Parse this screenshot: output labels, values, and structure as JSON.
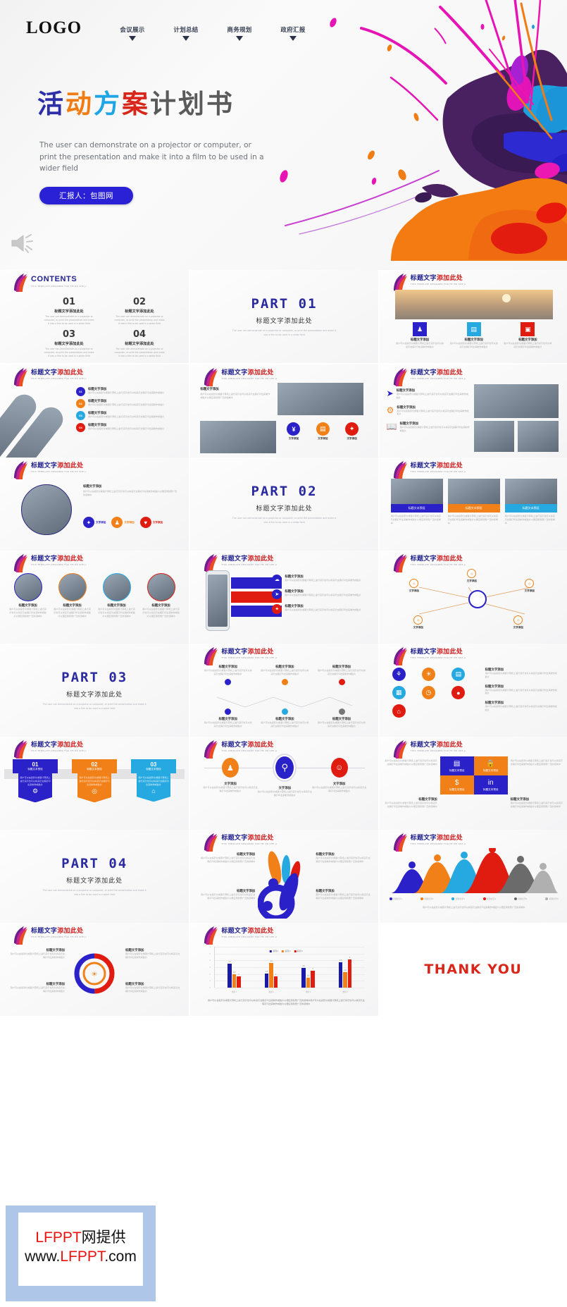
{
  "hero": {
    "logo": "LOGO",
    "nav": [
      {
        "label": "会议展示"
      },
      {
        "label": "计划总结"
      },
      {
        "label": "商务规划"
      },
      {
        "label": "政府汇报"
      }
    ],
    "title_chars": [
      "活",
      "动",
      "方",
      "案",
      "计",
      "划",
      "书"
    ],
    "subtitle": "The user can demonstrate on a projector or computer, or print the presentation and make it into a film to be used in a wider field",
    "presenter_button": "汇报人：包图网"
  },
  "slide_header": {
    "title_blue": "标题文字",
    "title_red": "添加此处",
    "subtitle_en": "THIS TEMPLATE DESIGNED FOR FEI ER SHE JI"
  },
  "contents": {
    "title": "CONTENTS",
    "subtitle_en": "THIS TEMPLATE DESIGNED FOR FEI ER SHE JI",
    "items": [
      {
        "num": "01",
        "title": "标题文字添加此处",
        "desc": "The user can demonstrate on a projector or computer, or print the presentation and make it into a film to be used in a wider field"
      },
      {
        "num": "02",
        "title": "标题文字添加此处",
        "desc": "The user can demonstrate on a projector or computer, or print the presentation and make it into a film to be used in a wider field"
      },
      {
        "num": "03",
        "title": "标题文字添加此处",
        "desc": "The user can demonstrate on a projector or computer, or print the presentation and make it into a film to be used in a wider field"
      },
      {
        "num": "04",
        "title": "标题文字添加此处",
        "desc": "The user can demonstrate on a projector or computer, or print the presentation and make it into a film to be used in a wider field"
      }
    ]
  },
  "parts": [
    {
      "big": "PART 01",
      "sub": "标题文字添加此处",
      "en": "The user can demonstrate on a projector or computer, or print the presentation and make it into a film to be used in a wider field"
    },
    {
      "big": "PART 02",
      "sub": "标题文字添加此处",
      "en": "The user can demonstrate on a projector or computer, or print the presentation and make it into a film to be used in a wider field"
    },
    {
      "big": "PART 03",
      "sub": "标题文字添加此处",
      "en": "The user can demonstrate on a projector or computer, or print the presentation and make it into a film to be used in a wider field"
    },
    {
      "big": "PART 04",
      "sub": "标题文字添加此处",
      "en": "The user can demonstrate on a projector or computer, or print the presentation and make it into a film to be used in a wider field"
    }
  ],
  "common": {
    "item_title": "标题文字添加",
    "text_add": "文字添加",
    "box_label": "标题文本预设",
    "body": "用户可以在投影仪或者计算机上进行演示也可以将演示文稿打印出来制作成胶片以便应用到更广泛的领域中",
    "body_short": "用户可以在投影仪或者计算机上进行演示也可以将演示文稿打印出来制作成胶片"
  },
  "closing": {
    "thank_you": "THANK YOU"
  },
  "chart_data": {
    "type": "bar",
    "title": "标题文字添加此处",
    "categories": [
      "类别 1",
      "类别 2",
      "类别 3",
      "类别 4"
    ],
    "series": [
      {
        "name": "系列 1",
        "color": "#1a1aa8",
        "values": [
          4.3,
          2.5,
          3.5,
          4.5
        ]
      },
      {
        "name": "系列 2",
        "color": "#f28019",
        "values": [
          2.4,
          4.4,
          1.8,
          2.8
        ]
      },
      {
        "name": "系列 3",
        "color": "#e01b10",
        "values": [
          2.0,
          2.0,
          3.0,
          5.0
        ]
      }
    ],
    "ylim": [
      0,
      6
    ],
    "yticks": [
      0,
      1,
      2,
      3,
      4,
      5,
      6
    ],
    "xlabel": "",
    "ylabel": "",
    "grid": true,
    "legend_position": "top-center",
    "note": "用户可以在投影仪或者计算机上进行演示也可以将演示文稿打印出来制作成胶片以便应用到更广泛的领域中用户可以在投影仪或者计算机上进行演示也可以将演示文稿打印出来制作成胶片以便应用到更广泛的领域中"
  },
  "funnel_chart": {
    "type": "area",
    "legend": [
      "标题文字1",
      "标题文字2",
      "标题文字3",
      "标题文字4",
      "标题文字5",
      "标题文字6"
    ],
    "colors": [
      "#2a21c8",
      "#f28019",
      "#26a9e0",
      "#e01b10",
      "#6b6b6b",
      "#b0b0b0"
    ],
    "values": [
      52,
      68,
      78,
      100,
      72,
      46
    ],
    "note": "用户可以在投影仪或者计算机上进行演示也可以将演示文稿打印出来制作成胶片以便应用到更广泛的领域中"
  },
  "colors": {
    "brand_blue": "#2a21d6",
    "brand_orange": "#f07c14",
    "brand_cyan": "#1da5e6",
    "brand_red": "#d8261b",
    "ink_purple": "#4a2160"
  },
  "watermark": {
    "line1_red": "LFPPT",
    "line1_black": "网提供",
    "line2_a": "www.",
    "line2_red": "LFPPT",
    "line2_b": ".com"
  }
}
